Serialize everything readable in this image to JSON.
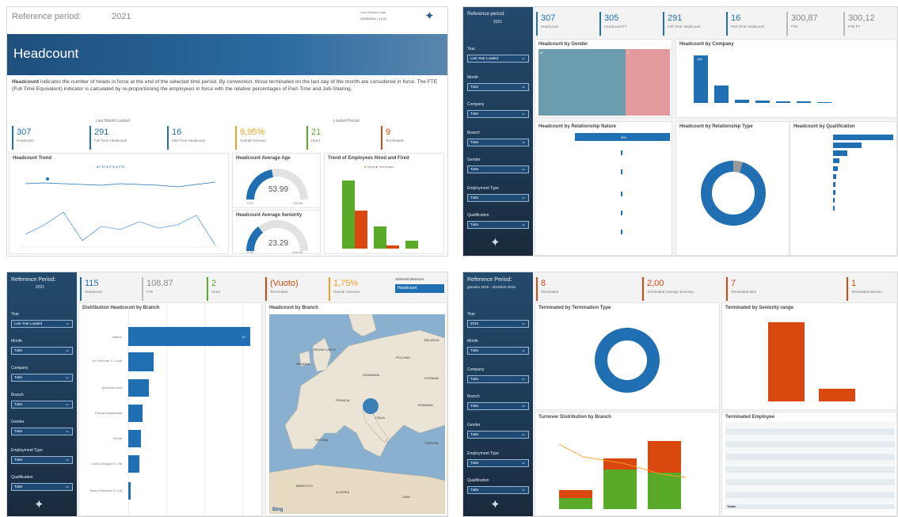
{
  "colors": {
    "blue": "#1f6fb2",
    "green": "#5aaa2a",
    "red": "#d9480f",
    "orange": "#f0a020",
    "teal": "#6b9dae",
    "pink": "#e39a9c",
    "navy": "#1d3b57"
  },
  "tl": {
    "ref_label": "Reference period:",
    "ref_year": "2021",
    "last_refresh_label": "Last Refresh Date",
    "last_refresh": "20/05/2021 | 12:02",
    "banner_title": "Headcount",
    "desc_bold": "Headcount",
    "desc": " indicates the number of heads in force at the end of the selected time period. By convention, those terminated on the last day of the month are considered in force. The FTE (Full Time Equivalent) indicator is calculated by re-proportioning the employees in force with the relative percentages of Part-Time and Job-Sharing.",
    "last_month_loaded": "Last Month Loaded",
    "loaded_period": "Loaded Period",
    "kpis": [
      {
        "v": "307",
        "l": "Headcount"
      },
      {
        "v": "291",
        "l": "Full Time Headcount"
      },
      {
        "v": "16",
        "l": "Part Time Headcount"
      },
      {
        "v": "9,95%",
        "l": "Overall Turnover"
      },
      {
        "v": "21",
        "l": "Hired"
      },
      {
        "v": "9",
        "l": "Terminated"
      }
    ],
    "trend_title": "Headcount Trend",
    "trend_legend": "● FTE ● FTE ● FTE",
    "age_title": "Headcount Average Age",
    "age_value": "53.99",
    "age_min": "0.00",
    "age_max": "100.00",
    "seniority_title": "Headcount Average Seniority",
    "seniority_value": "23.29",
    "sen_min": "0.00",
    "sen_max": "100.00",
    "hired_title": "Trend of Employees Hired and Fired",
    "hired_legend_a": "Hired",
    "hired_legend_b": "Terminated"
  },
  "tr": {
    "ref_label": "Reference period:",
    "ref_year": "2021",
    "kpis": [
      {
        "v": "307",
        "l": "Headcount"
      },
      {
        "v": "305",
        "l": "Headcount FT"
      },
      {
        "v": "291",
        "l": "Full Time Headcount"
      },
      {
        "v": "16",
        "l": "Part Time Headcount"
      },
      {
        "v": "300,87",
        "l": "FTE"
      },
      {
        "v": "300,12",
        "l": "FTE FT"
      }
    ],
    "filters": [
      {
        "label": "Year",
        "value": "Last Year Loaded"
      },
      {
        "label": "Month",
        "value": "Tutte"
      },
      {
        "label": "Company",
        "value": "Tutte"
      },
      {
        "label": "Branch",
        "value": "Tutte"
      },
      {
        "label": "Gender",
        "value": "Tutte"
      },
      {
        "label": "Employment Type",
        "value": "Tutte"
      },
      {
        "label": "Qualification",
        "value": "Tutte"
      }
    ],
    "gender_title": "Headcount by Gender",
    "gender_a": "M",
    "gender_b": "F",
    "company_title": "Headcount by Company",
    "company_top": "165",
    "rel_title": "Headcount by Relationship Nature",
    "rel_value": "300",
    "rtype_title": "Headcount by Relationship Type",
    "qual_title": "Headcount by Qualification"
  },
  "bl": {
    "ref_label": "Reference Period:",
    "ref_year": "2021",
    "kpis": [
      {
        "v": "115",
        "l": "Headcount"
      },
      {
        "v": "108,87",
        "l": "FTE"
      },
      {
        "v": "2",
        "l": "Hired"
      },
      {
        "v": "(Vuoto)",
        "l": "Terminated"
      },
      {
        "v": "1,75%",
        "l": "Overall Turnover"
      }
    ],
    "measure_label": "Selected Measure",
    "measure_value": "Headcount",
    "filters": [
      {
        "label": "Year",
        "value": "Last Year Loaded"
      },
      {
        "label": "Month",
        "value": "Tutte"
      },
      {
        "label": "Company",
        "value": "Tutte"
      },
      {
        "label": "Branch",
        "value": "Tutte"
      },
      {
        "label": "Gender",
        "value": "Tutte"
      },
      {
        "label": "Employment Type",
        "value": "Tutte"
      },
      {
        "label": "Qualification",
        "value": "Tutte"
      }
    ],
    "dist_title": "Distribution Headcount by Branch",
    "branches": [
      {
        "name": "Milano",
        "val": "67"
      },
      {
        "name": "Sol Federale S. Lucia",
        "val": ""
      },
      {
        "name": "Quinzano Dort",
        "val": ""
      },
      {
        "name": "Piazza Lampedusa",
        "val": ""
      },
      {
        "name": "Roma",
        "val": ""
      },
      {
        "name": "Lodi & Bologna S. Ma",
        "val": ""
      },
      {
        "name": "Sesto Pianezza S. Lda",
        "val": ""
      }
    ],
    "map_title": "Headcount by Branch",
    "map_labels": [
      "REGNO UNITO",
      "FRANCIA",
      "GERMANIA",
      "POLONIA",
      "UCRAINA",
      "ITALIA",
      "SPAGNA",
      "ALGERIA",
      "LIBIA",
      "MAROCCO",
      "IRLANDA",
      "ROMANIA",
      "BELARUS",
      "TURCHIA"
    ],
    "bing": "Bing"
  },
  "br": {
    "ref_label": "Reference Period:",
    "ref_range": "gennaio 2015 - dicembre 2015",
    "kpis": [
      {
        "v": "8",
        "l": "Terminated"
      },
      {
        "v": "2,00",
        "l": "Terminated Average Seniority"
      },
      {
        "v": "7",
        "l": "Terminated Men"
      },
      {
        "v": "1",
        "l": "Terminated Women"
      }
    ],
    "filters": [
      {
        "label": "Year",
        "value": "2015"
      },
      {
        "label": "Month",
        "value": "Tutte"
      },
      {
        "label": "Company",
        "value": "Tutte"
      },
      {
        "label": "Branch",
        "value": "Tutte"
      },
      {
        "label": "Gender",
        "value": "Tutte"
      },
      {
        "label": "Employment Type",
        "value": "Tutte"
      },
      {
        "label": "Qualification",
        "value": "Tutte"
      }
    ],
    "tt_title": "Terminated by Termination Type",
    "sen_title": "Terminated by Seniority range",
    "turnover_title": "Turnover Distribution by Branch",
    "emp_title": "Terminated Employee",
    "emp_total": "Totale"
  }
}
